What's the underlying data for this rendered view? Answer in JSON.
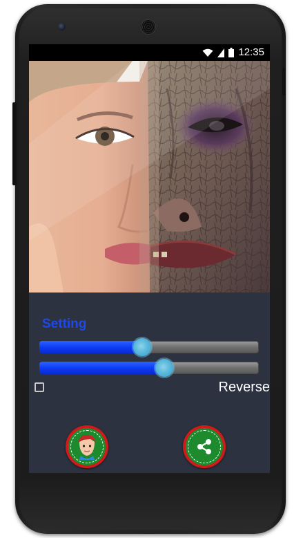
{
  "status_bar": {
    "time": "12:35",
    "icons": [
      "wifi-icon",
      "signal-icon",
      "battery-icon"
    ]
  },
  "photo": {
    "description_icon": "face-morph-image"
  },
  "settings": {
    "title": "Setting",
    "sliders": [
      {
        "name": "blend-slider-1",
        "value_percent": 47
      },
      {
        "name": "blend-slider-2",
        "value_percent": 57
      }
    ],
    "reverse": {
      "label": "Reverse",
      "checked": false
    }
  },
  "buttons": {
    "face": {
      "icon": "face-icon"
    },
    "share": {
      "icon": "share-icon"
    }
  },
  "colors": {
    "accent_blue": "#1f49e6",
    "button_red": "#d11b1b",
    "button_green": "#1d8a2d",
    "panel_bg": "#2d3240"
  }
}
